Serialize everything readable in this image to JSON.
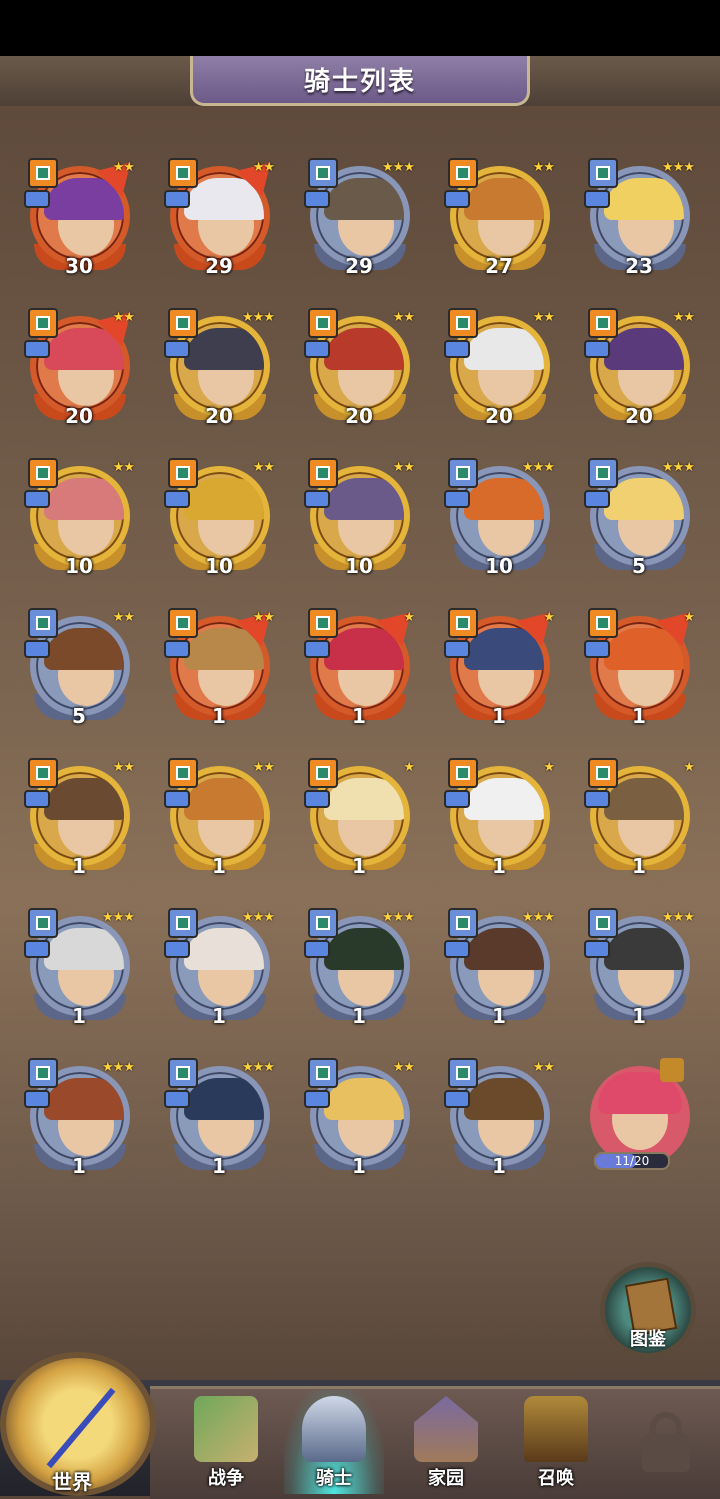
{
  "header": {
    "title": "骑士列表"
  },
  "knights": [
    {
      "level": "30",
      "stars": "★★",
      "frame": "red",
      "cls": "orange",
      "up": true,
      "hair": "#7a3ea0"
    },
    {
      "level": "29",
      "stars": "★★",
      "frame": "red",
      "cls": "orange",
      "up": true,
      "hair": "#e8e8ee"
    },
    {
      "level": "29",
      "stars": "★★★",
      "frame": "silver",
      "cls": "blue",
      "up": false,
      "hair": "#6a5a4a"
    },
    {
      "level": "27",
      "stars": "★★",
      "frame": "gold",
      "cls": "orange",
      "up": false,
      "hair": "#c87a30"
    },
    {
      "level": "23",
      "stars": "★★★",
      "frame": "silver",
      "cls": "blue",
      "up": false,
      "hair": "#f0d060"
    },
    {
      "level": "20",
      "stars": "★★",
      "frame": "red",
      "cls": "orange",
      "up": true,
      "hair": "#d84a5a"
    },
    {
      "level": "20",
      "stars": "★★★",
      "frame": "gold",
      "cls": "orange",
      "up": false,
      "hair": "#3e3e4e"
    },
    {
      "level": "20",
      "stars": "★★",
      "frame": "gold",
      "cls": "orange",
      "up": false,
      "hair": "#b83a2a"
    },
    {
      "level": "20",
      "stars": "★★",
      "frame": "gold",
      "cls": "orange",
      "up": false,
      "hair": "#e8e8e8"
    },
    {
      "level": "20",
      "stars": "★★",
      "frame": "gold",
      "cls": "orange",
      "up": false,
      "hair": "#5a3a7a"
    },
    {
      "level": "10",
      "stars": "★★",
      "frame": "gold",
      "cls": "orange",
      "up": false,
      "hair": "#d87a7a"
    },
    {
      "level": "10",
      "stars": "★★",
      "frame": "gold",
      "cls": "orange",
      "up": false,
      "hair": "#d8a830"
    },
    {
      "level": "10",
      "stars": "★★",
      "frame": "gold",
      "cls": "orange",
      "up": false,
      "hair": "#6a5a8a"
    },
    {
      "level": "10",
      "stars": "★★★",
      "frame": "silver",
      "cls": "blue",
      "up": false,
      "hair": "#d86a2a"
    },
    {
      "level": "5",
      "stars": "★★★",
      "frame": "silver",
      "cls": "blue",
      "up": false,
      "hair": "#f0d070"
    },
    {
      "level": "5",
      "stars": "★★",
      "frame": "silver",
      "cls": "blue",
      "up": false,
      "hair": "#7a4a2a"
    },
    {
      "level": "1",
      "stars": "★★",
      "frame": "red",
      "cls": "orange",
      "up": true,
      "hair": "#b8884a"
    },
    {
      "level": "1",
      "stars": "★",
      "frame": "red",
      "cls": "orange",
      "up": true,
      "hair": "#c8304a"
    },
    {
      "level": "1",
      "stars": "★",
      "frame": "red",
      "cls": "orange",
      "up": true,
      "hair": "#3a4a7a"
    },
    {
      "level": "1",
      "stars": "★",
      "frame": "red",
      "cls": "orange",
      "up": true,
      "hair": "#e0602a"
    },
    {
      "level": "1",
      "stars": "★★",
      "frame": "gold",
      "cls": "orange",
      "up": false,
      "hair": "#6a4a30"
    },
    {
      "level": "1",
      "stars": "★★",
      "frame": "gold",
      "cls": "orange",
      "up": false,
      "hair": "#c87a30"
    },
    {
      "level": "1",
      "stars": "★",
      "frame": "gold",
      "cls": "orange",
      "up": false,
      "hair": "#f0e0b0"
    },
    {
      "level": "1",
      "stars": "★",
      "frame": "gold",
      "cls": "orange",
      "up": false,
      "hair": "#f0f0f0"
    },
    {
      "level": "1",
      "stars": "★",
      "frame": "gold",
      "cls": "orange",
      "up": false,
      "hair": "#7a6040"
    },
    {
      "level": "1",
      "stars": "★★★",
      "frame": "silver",
      "cls": "blue",
      "up": false,
      "hair": "#d8d8d8"
    },
    {
      "level": "1",
      "stars": "★★★",
      "frame": "silver",
      "cls": "blue",
      "up": false,
      "hair": "#e8e0d8"
    },
    {
      "level": "1",
      "stars": "★★★",
      "frame": "silver",
      "cls": "blue",
      "up": false,
      "hair": "#2a3a2a"
    },
    {
      "level": "1",
      "stars": "★★★",
      "frame": "silver",
      "cls": "blue",
      "up": false,
      "hair": "#5a3a2a"
    },
    {
      "level": "1",
      "stars": "★★★",
      "frame": "silver",
      "cls": "blue",
      "up": false,
      "hair": "#3a3a3a"
    },
    {
      "level": "1",
      "stars": "★★★",
      "frame": "silver",
      "cls": "blue",
      "up": false,
      "hair": "#9a4a2a"
    },
    {
      "level": "1",
      "stars": "★★★",
      "frame": "silver",
      "cls": "blue",
      "up": false,
      "hair": "#2a3a5a"
    },
    {
      "level": "1",
      "stars": "★★",
      "frame": "silver",
      "cls": "blue",
      "up": false,
      "hair": "#e8c060"
    },
    {
      "level": "1",
      "stars": "★★",
      "frame": "silver",
      "cls": "blue",
      "up": false,
      "hair": "#6a4a2a"
    }
  ],
  "shard": {
    "progress_text": "11/20",
    "progress": 0.55
  },
  "codex": {
    "label": "图鉴"
  },
  "nav": {
    "world": "世界",
    "war": "战争",
    "knights": "骑士",
    "home": "家园",
    "summon": "召唤"
  }
}
